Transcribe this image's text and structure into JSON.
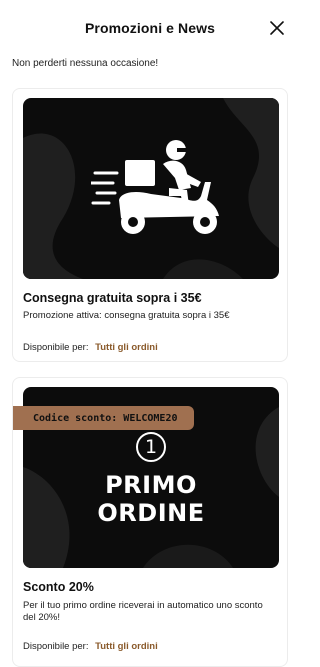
{
  "header": {
    "title": "Promozioni e News"
  },
  "subtitle": "Non perderti nessuna occasione!",
  "promotions": [
    {
      "title": "Consegna gratuita sopra i 35€",
      "description": "Promozione attiva: consegna gratuita sopra i 35€",
      "availability_label": "Disponibile per:",
      "availability_value": "Tutti gli ordini",
      "banner_icon": "delivery-scooter-icon"
    },
    {
      "promo_code_label": "Codice sconto: WELCOME20",
      "banner_number": "1",
      "banner_line1": "PRIMO",
      "banner_line2": "ORDINE",
      "title": "Sconto 20%",
      "description": "Per il tuo primo ordine riceverai in automatico uno sconto del 20%!",
      "availability_label": "Disponibile per:",
      "availability_value": "Tutti gli ordini"
    }
  ],
  "colors": {
    "accent": "#8a5a2b",
    "tag_bg": "#a07050",
    "banner_bg": "#0c0c0c"
  }
}
